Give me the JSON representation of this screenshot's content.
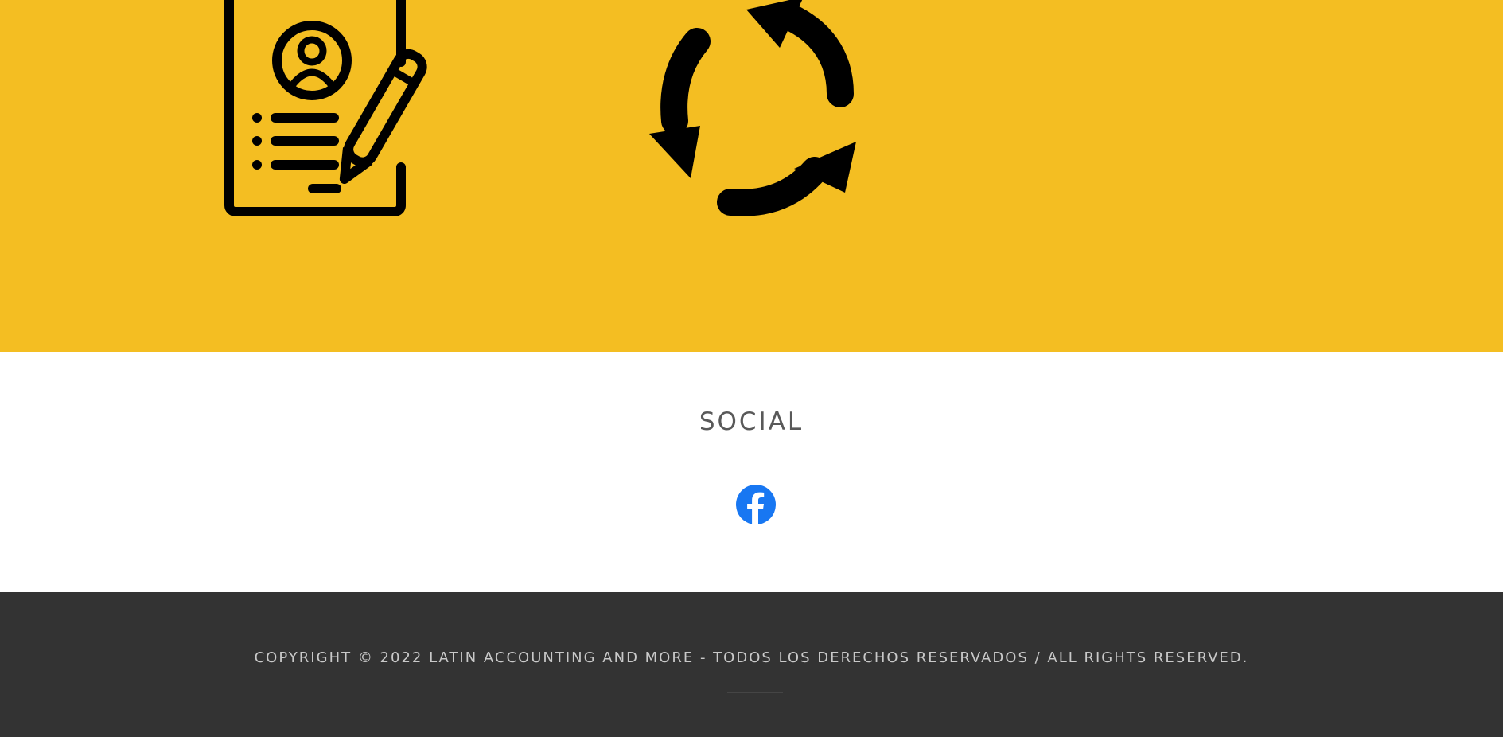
{
  "features": {
    "background_color": "#f4be22",
    "icons": [
      {
        "name": "resume-document-icon"
      },
      {
        "name": "refresh-cycle-icon"
      }
    ]
  },
  "social": {
    "title": "SOCIAL",
    "links": [
      {
        "name": "facebook-icon",
        "color": "#1877f2"
      }
    ]
  },
  "footer": {
    "background_color": "#333333",
    "copyright": "COPYRIGHT © 2022 LATIN ACCOUNTING AND MORE - TODOS LOS DERECHOS RESERVADOS / ALL RIGHTS RESERVED."
  }
}
